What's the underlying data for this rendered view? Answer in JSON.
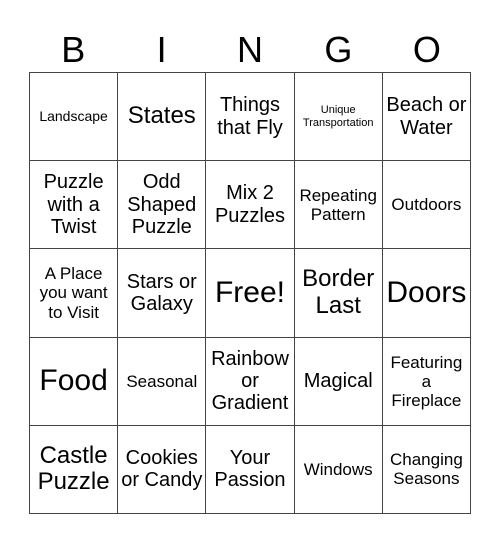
{
  "header": {
    "letters": [
      "B",
      "I",
      "N",
      "G",
      "O"
    ]
  },
  "card": {
    "cells": [
      [
        "Landscape",
        "States",
        "Things that Fly",
        "Unique Transportation",
        "Beach or Water"
      ],
      [
        "Puzzle with a Twist",
        "Odd Shaped Puzzle",
        "Mix 2 Puzzles",
        "Repeating Pattern",
        "Outdoors"
      ],
      [
        "A Place you want to Visit",
        "Stars or Galaxy",
        "Free!",
        "Border Last",
        "Doors"
      ],
      [
        "Food",
        "Seasonal",
        "Rainbow or Gradient",
        "Magical",
        "Featuring a Fireplace"
      ],
      [
        "Castle Puzzle",
        "Cookies or Candy",
        "Your Passion",
        "Windows",
        "Changing Seasons"
      ]
    ]
  }
}
